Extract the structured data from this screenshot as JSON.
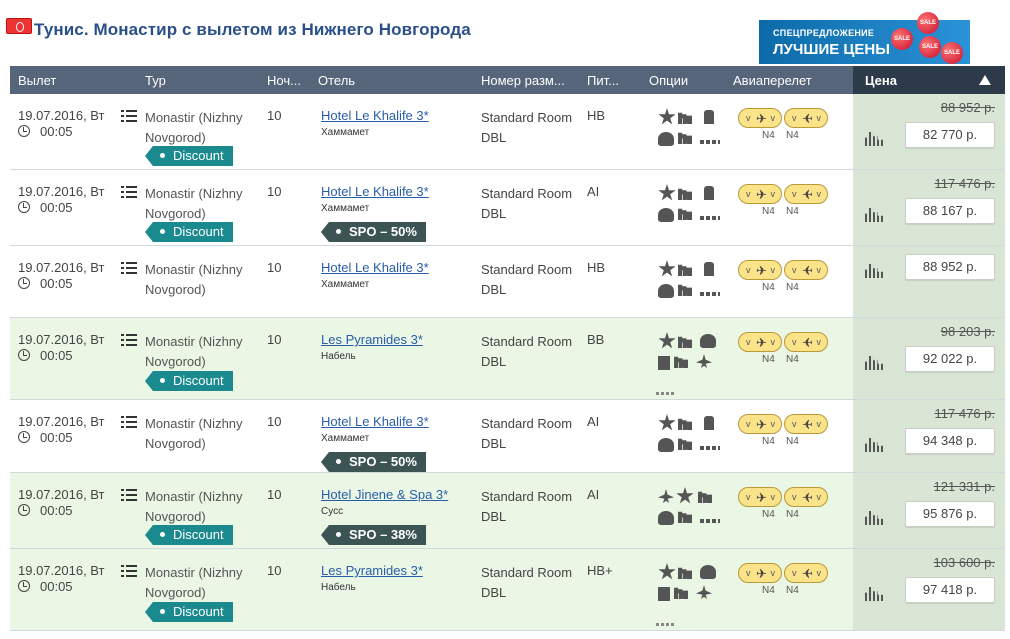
{
  "header": {
    "title": "Тунис. Монастир с вылетом из Нижнего Новгорода",
    "promo_small": "СПЕЦПРЕДЛОЖЕНИЕ",
    "promo_big": "ЛУЧШИЕ ЦЕНЫ",
    "balloon_text": "SALE"
  },
  "columns": {
    "departure": "Вылет",
    "tour": "Тур",
    "nights": "Ноч...",
    "hotel": "Отель",
    "room": "Номер разм...",
    "board": "Пит...",
    "options": "Опции",
    "flight": "Авиаперелет",
    "price": "Цена"
  },
  "rows": [
    {
      "date": "19.07.2016, Вт",
      "time": "00:05",
      "tour": "Monastir (Nizhny Novgorod)",
      "badge": "Discount",
      "nights": "10",
      "hotel": "Hotel Le Khalife 3*",
      "city": "Хаммамет",
      "room": "Standard Room DBL",
      "board": "HB",
      "flight_codes": [
        "N4",
        "N4"
      ],
      "old_price": "88 952 р.",
      "price": "82 770 р."
    },
    {
      "date": "19.07.2016, Вт",
      "time": "00:05",
      "tour": "Monastir (Nizhny Novgorod)",
      "badge": "Discount",
      "nights": "10",
      "hotel": "Hotel Le Khalife 3*",
      "city": "Хаммамет",
      "spo": "SPO – 50%",
      "room": "Standard Room DBL",
      "board": "AI",
      "flight_codes": [
        "N4",
        "N4"
      ],
      "old_price": "117 476 р.",
      "price": "88 167 р."
    },
    {
      "date": "19.07.2016, Вт",
      "time": "00:05",
      "tour": "Monastir (Nizhny Novgorod)",
      "nights": "10",
      "hotel": "Hotel Le Khalife 3*",
      "city": "Хаммамет",
      "room": "Standard Room DBL",
      "board": "HB",
      "flight_codes": [
        "N4",
        "N4"
      ],
      "price": "88 952 р."
    },
    {
      "date": "19.07.2016, Вт",
      "time": "00:05",
      "tour": "Monastir (Nizhny Novgorod)",
      "badge": "Discount",
      "nights": "10",
      "hotel": "Les Pyramides 3*",
      "city": "Набель",
      "room": "Standard Room DBL",
      "board": "BB",
      "flight_codes": [
        "N4",
        "N4"
      ],
      "old_price": "98 203 р.",
      "price": "92 022 р."
    },
    {
      "date": "19.07.2016, Вт",
      "time": "00:05",
      "tour": "Monastir (Nizhny Novgorod)",
      "nights": "10",
      "hotel": "Hotel Le Khalife 3*",
      "city": "Хаммамет",
      "spo": "SPO – 50%",
      "room": "Standard Room DBL",
      "board": "AI",
      "flight_codes": [
        "N4",
        "N4"
      ],
      "old_price": "117 476 р.",
      "price": "94 348 р."
    },
    {
      "date": "19.07.2016, Вт",
      "time": "00:05",
      "tour": "Monastir (Nizhny Novgorod)",
      "badge": "Discount",
      "nights": "10",
      "hotel": "Hotel Jinene & Spa 3*",
      "city": "Сусс",
      "spo": "SPO – 38%",
      "room": "Standard Room DBL",
      "board": "AI",
      "flight_codes": [
        "N4",
        "N4"
      ],
      "old_price": "121 331 р.",
      "price": "95 876 р."
    },
    {
      "date": "19.07.2016, Вт",
      "time": "00:05",
      "tour": "Monastir (Nizhny Novgorod)",
      "badge": "Discount",
      "nights": "10",
      "hotel": "Les Pyramides 3*",
      "city": "Набель",
      "room": "Standard Room DBL",
      "board": "HB+",
      "flight_codes": [
        "N4",
        "N4"
      ],
      "old_price": "103 600 р.",
      "price": "97 418 р."
    }
  ],
  "colors": {
    "header_bg": "#566579",
    "price_header_bg": "#2d3a4a",
    "discount_badge": "#1b8a8f",
    "spo_badge": "#3d5454",
    "green_row": "#e9f7e4",
    "flight_pill": "#fbe38a",
    "hotel_link": "#2a5da8"
  }
}
